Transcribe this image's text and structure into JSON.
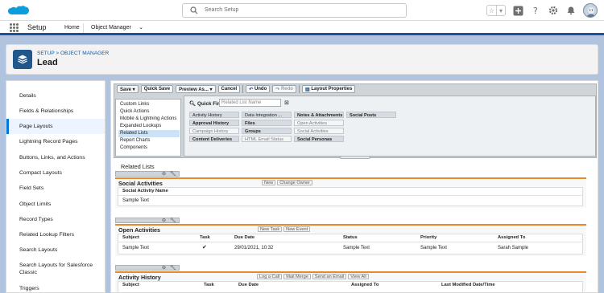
{
  "header": {
    "search_placeholder": "Search Setup",
    "icons": [
      "salesforce-cloud-logo",
      "search-icon",
      "star-icon",
      "chevron-down-icon",
      "plus-icon",
      "help-icon",
      "gear-icon",
      "bell-icon",
      "avatar-icon"
    ]
  },
  "app_nav": {
    "app_name": "Setup",
    "home_tab": "Home",
    "object_manager_tab": "Object Manager"
  },
  "page": {
    "breadcrumb": "SETUP > OBJECT MANAGER",
    "title": "Lead"
  },
  "left_nav": {
    "items": [
      {
        "label": "Details"
      },
      {
        "label": "Fields & Relationships"
      },
      {
        "label": "Page Layouts",
        "active": true
      },
      {
        "label": "Lightning Record Pages"
      },
      {
        "label": "Buttons, Links, and Actions"
      },
      {
        "label": "Compact Layouts"
      },
      {
        "label": "Field Sets"
      },
      {
        "label": "Object Limits"
      },
      {
        "label": "Record Types"
      },
      {
        "label": "Related Lookup Filters"
      },
      {
        "label": "Search Layouts"
      },
      {
        "label": "Search Layouts for Salesforce Classic"
      },
      {
        "label": "Triggers"
      }
    ]
  },
  "toolbar": {
    "save": "Save ▾",
    "quick_save": "Quick Save",
    "preview_as": "Preview As... ▾",
    "cancel": "Cancel",
    "undo": "Undo",
    "redo": "Redo",
    "layout_properties": "Layout Properties"
  },
  "palette": {
    "categories": [
      "Custom Links",
      "Quick Actions",
      "Mobile & Lightning Actions",
      "Expanded Lookups",
      "Related Lists",
      "Report Charts",
      "Components"
    ],
    "active_category": "Related Lists",
    "quick_find_label": "Quick Find",
    "quick_find_placeholder": "Related List Name",
    "items": [
      [
        "Activity History",
        "Data Integration ...",
        "Notes & Attachments",
        "Social Posts"
      ],
      [
        "Approval History",
        "Files",
        "Open Activities",
        ""
      ],
      [
        "Campaign History",
        "Groups",
        "Social Activities",
        ""
      ],
      [
        "Content Deliveries",
        "HTML Email Status",
        "Social Personas",
        ""
      ]
    ]
  },
  "canvas": {
    "section_title": "Related Lists",
    "related_lists": [
      {
        "name": "Social Activities",
        "buttons": [
          "New",
          "Change Owner"
        ],
        "columns": [
          "Social Activity Name"
        ],
        "rows": [
          [
            "Sample Text"
          ]
        ]
      },
      {
        "name": "Open Activities",
        "buttons": [
          "New Task",
          "New Event"
        ],
        "columns": [
          "Subject",
          "Task",
          "Due Date",
          "Status",
          "Priority",
          "Assigned To"
        ],
        "rows": [
          [
            "Sample Text",
            "✔",
            "29/01/2021, 10:32",
            "Sample Text",
            "Sample Text",
            "Sarah Sample"
          ]
        ]
      },
      {
        "name": "Activity History",
        "buttons": [
          "Log a Call",
          "Mail Merge",
          "Send an Email",
          "View All"
        ],
        "columns": [
          "Subject",
          "Task",
          "Due Date",
          "Assigned To",
          "Last Modified Date/Time"
        ],
        "rows": []
      }
    ]
  }
}
